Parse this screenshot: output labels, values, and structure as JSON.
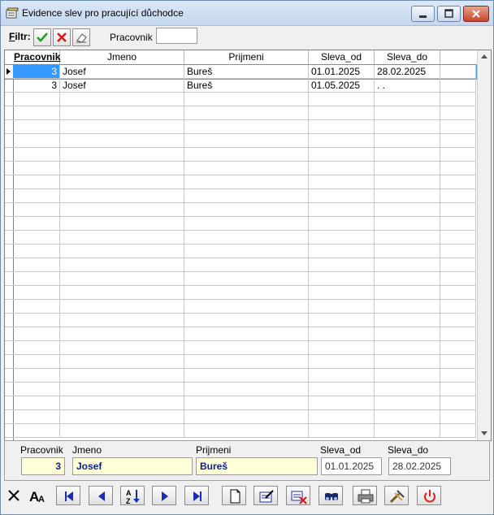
{
  "window": {
    "title": "Evidence slev pro pracující důchodce"
  },
  "filter": {
    "label_underlined": "F",
    "label_rest": "iltr:",
    "pracovnik_label": "Pracovnik",
    "pracovnik_value": ""
  },
  "grid": {
    "columns": [
      "Pracovnik",
      "Jmeno",
      "Prijmeni",
      "Sleva_od",
      "Sleva_do"
    ],
    "rows": [
      {
        "pracovnik": "3",
        "jmeno": "Josef",
        "prijmeni": "Bureš",
        "sleva_od": "01.01.2025",
        "sleva_do": "28.02.2025"
      },
      {
        "pracovnik": "3",
        "jmeno": "Josef",
        "prijmeni": "Bureš",
        "sleva_od": "01.05.2025",
        "sleva_do": ". ."
      }
    ],
    "selected_row": 0
  },
  "detail": {
    "labels": {
      "pracovnik": "Pracovnik",
      "jmeno": "Jmeno",
      "prijmeni": "Prijmeni",
      "sleva_od": "Sleva_od",
      "sleva_do": "Sleva_do"
    },
    "values": {
      "pracovnik": "3",
      "jmeno": "Josef",
      "prijmeni": "Bureš",
      "sleva_od": "01.01.2025",
      "sleva_do": "28.02.2025"
    }
  },
  "icons": {
    "filter_apply": "checkmark-icon",
    "filter_cancel": "x-icon",
    "filter_clear": "eraser-icon",
    "toolbar": [
      "close-x-icon",
      "font-icon",
      "first-record-icon",
      "previous-record-icon",
      "sort-az-icon",
      "next-record-icon",
      "last-record-icon",
      "new-document-icon",
      "edit-icon",
      "delete-icon",
      "find-icon",
      "print-icon",
      "tools-icon",
      "power-icon"
    ]
  },
  "colors": {
    "selection": "#3399ff",
    "detail_field_bg": "#ffffd8",
    "detail_field_text": "#0a1e8c",
    "nav_arrow": "#1a2bb5",
    "power": "#e02020"
  }
}
